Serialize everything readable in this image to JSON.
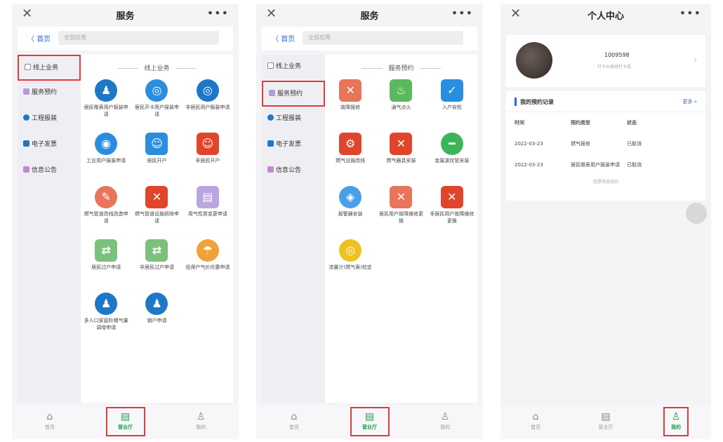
{
  "panels": [
    {
      "title": "服务",
      "back_label": "首页",
      "search_placeholder": "全部应用",
      "sidebar": [
        "线上业务",
        "服务预约",
        "工程报装",
        "电子发票",
        "信息公告"
      ],
      "section_title": "线上业务",
      "tiles": [
        {
          "label": "居民赠表用户报装申请",
          "icon": "person-icon",
          "color": "#1e78c8"
        },
        {
          "label": "居民开卡用户报装申请",
          "icon": "meter-icon",
          "color": "#2a8ee0"
        },
        {
          "label": "非居民用户报装申请",
          "icon": "meter-icon",
          "color": "#1e78c8"
        },
        {
          "label": "工业用户报装申请",
          "icon": "gas-icon",
          "color": "#2a8ee0"
        },
        {
          "label": "居民开户",
          "icon": "user-icon",
          "color": "#2a8ee0"
        },
        {
          "label": "非居民开户",
          "icon": "user-icon",
          "color": "#e0442a"
        },
        {
          "label": "燃气管道改线改造申请",
          "icon": "wrench-icon",
          "color": "#e8745a"
        },
        {
          "label": "燃气管道设施拆除申请",
          "icon": "tools-icon",
          "color": "#e0442a"
        },
        {
          "label": "用气性质变更申请",
          "icon": "doc-icon",
          "color": "#b9a6e0"
        },
        {
          "label": "居民过户申请",
          "icon": "transfer-icon",
          "color": "#7cc07e"
        },
        {
          "label": "非居民过户申请",
          "icon": "transfer-icon",
          "color": "#7cc07e"
        },
        {
          "label": "低保户气价优惠申请",
          "icon": "umbrella-icon",
          "color": "#f0a23a"
        },
        {
          "label": "多人口家庭阶梯气量调增申请",
          "icon": "person-icon",
          "color": "#1e78c8"
        },
        {
          "label": "销户申请",
          "icon": "person-icon",
          "color": "#1e78c8"
        }
      ],
      "tabs": [
        {
          "label": "首页",
          "icon": "home-icon"
        },
        {
          "label": "营业厅",
          "icon": "hall-icon"
        },
        {
          "label": "我的",
          "icon": "person-icon"
        }
      ]
    },
    {
      "title": "服务",
      "back_label": "首页",
      "search_placeholder": "全部应用",
      "sidebar": [
        "线上业务",
        "服务预约",
        "工程报装",
        "电子发票",
        "信息公告"
      ],
      "section_title": "服务预约",
      "tiles": [
        {
          "label": "故障报修",
          "icon": "tools-icon",
          "color": "#e8745a"
        },
        {
          "label": "通气点火",
          "icon": "fire-icon",
          "color": "#5cb85c"
        },
        {
          "label": "入户安检",
          "icon": "shield-icon",
          "color": "#2a8ee0"
        },
        {
          "label": "燃气设施改线",
          "icon": "gear-icon",
          "color": "#e0442a"
        },
        {
          "label": "燃气器具安装",
          "icon": "tools-icon",
          "color": "#e0442a"
        },
        {
          "label": "金属波纹管安装",
          "icon": "pipe-icon",
          "color": "#3cb55a"
        },
        {
          "label": "报警器安装",
          "icon": "alarm-icon",
          "color": "#4aa0e8"
        },
        {
          "label": "居民用户故障维修更换",
          "icon": "tools-icon",
          "color": "#e8745a"
        },
        {
          "label": "非居民用户故障维修更换",
          "icon": "tools-icon",
          "color": "#e0442a"
        },
        {
          "label": "流量计(燃气表)检定",
          "icon": "meter-icon",
          "color": "#f0c020"
        }
      ],
      "tabs": [
        {
          "label": "首页",
          "icon": "home-icon"
        },
        {
          "label": "营业厅",
          "icon": "hall-icon"
        },
        {
          "label": "我的",
          "icon": "person-icon"
        }
      ]
    },
    {
      "title": "个人中心",
      "user_id": "1009598",
      "user_sub": "打卡长盈她打卡低",
      "records_title": "我的预约记录",
      "records_more": "更多 »",
      "columns": [
        "时间",
        "预约类型",
        "状态"
      ],
      "rows": [
        [
          "2022-03-23",
          "燃气报修",
          "已取消"
        ],
        [
          "2022-03-23",
          "居民赠表用户报装申请",
          "已取消"
        ]
      ],
      "records_footer": "我是有底线的",
      "tabs": [
        {
          "label": "首页",
          "icon": "home-icon"
        },
        {
          "label": "营业厅",
          "icon": "hall-icon"
        },
        {
          "label": "我的",
          "icon": "person-icon"
        }
      ]
    }
  ]
}
